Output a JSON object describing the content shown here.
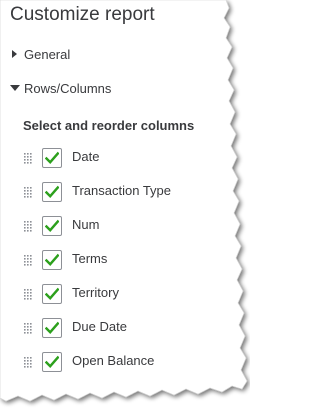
{
  "panel": {
    "title": "Customize report"
  },
  "sections": {
    "general": {
      "label": "General",
      "expanded": false
    },
    "rows_columns": {
      "label": "Rows/Columns",
      "expanded": true,
      "subtitle": "Select and reorder columns"
    }
  },
  "columns": [
    {
      "label": "Date",
      "checked": true
    },
    {
      "label": "Transaction Type",
      "checked": true
    },
    {
      "label": "Num",
      "checked": true
    },
    {
      "label": "Terms",
      "checked": true
    },
    {
      "label": "Territory",
      "checked": true
    },
    {
      "label": "Due Date",
      "checked": true
    },
    {
      "label": "Open Balance",
      "checked": true
    }
  ],
  "icons": {
    "collapsed": "caret-right-icon",
    "expanded": "caret-down-icon",
    "drag": "drag-handle-icon",
    "check": "checkmark-icon"
  },
  "colors": {
    "text": "#393a3d",
    "check": "#2ca01c",
    "checkbox_border": "#8d9096",
    "grip": "#8d9096"
  }
}
